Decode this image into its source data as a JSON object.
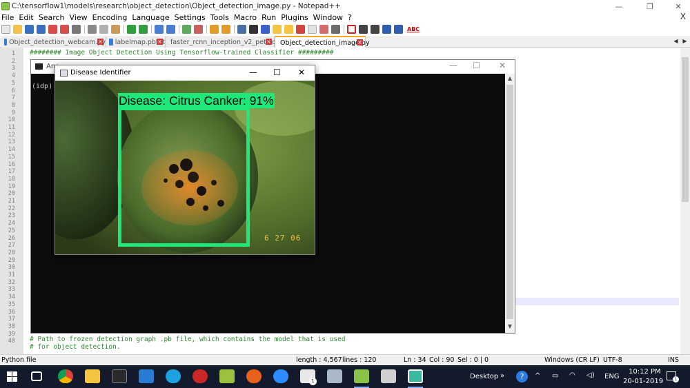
{
  "window": {
    "title": "C:\\tensorflow1\\models\\research\\object_detection\\Object_detection_image.py - Notepad++"
  },
  "menu": [
    "File",
    "Edit",
    "Search",
    "View",
    "Encoding",
    "Language",
    "Settings",
    "Tools",
    "Macro",
    "Run",
    "Plugins",
    "Window",
    "?"
  ],
  "menu_close": "X",
  "toolbar": {
    "spellcheck_label": "ABC"
  },
  "tabs": [
    {
      "label": "Object_detection_webcam.py",
      "active": false
    },
    {
      "label": "labelmap.pbtxt",
      "active": false
    },
    {
      "label": "faster_rcnn_inception_v2_pets.config",
      "active": false
    },
    {
      "label": "Object_detection_image.py",
      "active": true
    }
  ],
  "editor": {
    "line_numbers": [
      "1",
      "2",
      "3",
      "4",
      "5",
      "6",
      "7",
      "8",
      "9",
      "10",
      "11",
      "12",
      "13",
      "14",
      "15",
      "16",
      "17",
      "18",
      "19",
      "20",
      "21",
      "22",
      "23",
      "24",
      "25",
      "26",
      "27",
      "28",
      "29",
      "30",
      "31",
      "32",
      "33",
      "34",
      "35",
      "36",
      "37",
      "38",
      "39",
      "40"
    ],
    "lines": {
      "line1": "######## Image Object Detection Using Tensorflow-trained Classifier #########",
      "line39": "# Path to frozen detection graph .pb file, which contains the model that is used",
      "line40": "# for object detection."
    }
  },
  "console": {
    "title": "Ana",
    "text": "(idp)"
  },
  "disease_window": {
    "title": "Disease Identifier",
    "detection_label": "Disease: Citrus Canker: 91%",
    "date_stamp": "6 27 06"
  },
  "statusbar": {
    "file_type": "Python file",
    "length": "length : 4,567",
    "lines": "lines : 120",
    "ln": "Ln : 34",
    "col": "Col : 90",
    "sel": "Sel : 0 | 0",
    "eol": "Windows (CR LF)",
    "encoding": "UTF-8",
    "mode": "INS"
  },
  "taskbar": {
    "desktop_label": "Desktop",
    "language": "ENG",
    "time": "10:12 PM",
    "date": "20-01-2019",
    "notification_count": "1"
  },
  "colors": {
    "detection_box": "#1ee87a",
    "editor_comment": "#2e8b2e",
    "taskbar_bg": "#121a2b"
  }
}
